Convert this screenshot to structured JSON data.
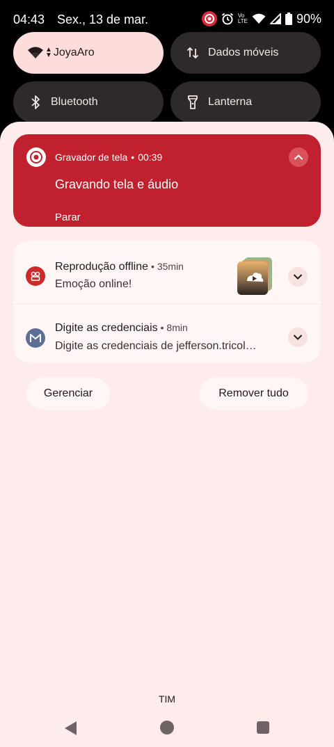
{
  "status_bar": {
    "time": "04:43",
    "date": "Sex., 13 de mar.",
    "icons": [
      "screen-record-icon",
      "alarm-icon",
      "volte-icon",
      "wifi-icon",
      "signal-icon",
      "battery-icon"
    ],
    "volte_top": "Vo",
    "volte_bottom": "LTE",
    "battery": "90%"
  },
  "quick_settings": {
    "tiles": [
      {
        "label": "JoyaAro",
        "icon": "wifi-icon",
        "active": true
      },
      {
        "label": "Dados móveis",
        "icon": "mobile-data-icon",
        "active": false
      },
      {
        "label": "Bluetooth",
        "icon": "bluetooth-icon",
        "active": false
      },
      {
        "label": "Lanterna",
        "icon": "flashlight-icon",
        "active": false
      }
    ]
  },
  "recording": {
    "app": "Gravador de tela",
    "elapsed": "00:39",
    "title": "Gravando tela e áudio",
    "stop_label": "Parar"
  },
  "notifications": [
    {
      "app": "Reprodução offline",
      "time": "35min",
      "text": "Emoção online!",
      "icon": "offline-playback-icon"
    },
    {
      "app": "Digite as credenciais",
      "time": "8min",
      "text": "Digite as credenciais de jefferson.tricol…",
      "icon": "mail-icon"
    }
  ],
  "actions": {
    "manage": "Gerenciar",
    "clear_all": "Remover tudo"
  },
  "carrier": "TIM",
  "colors": {
    "recording_card": "#c1212f",
    "shade_background": "#fdeceb",
    "active_tile": "#fddcdc",
    "inactive_tile": "#2e2a2b"
  }
}
